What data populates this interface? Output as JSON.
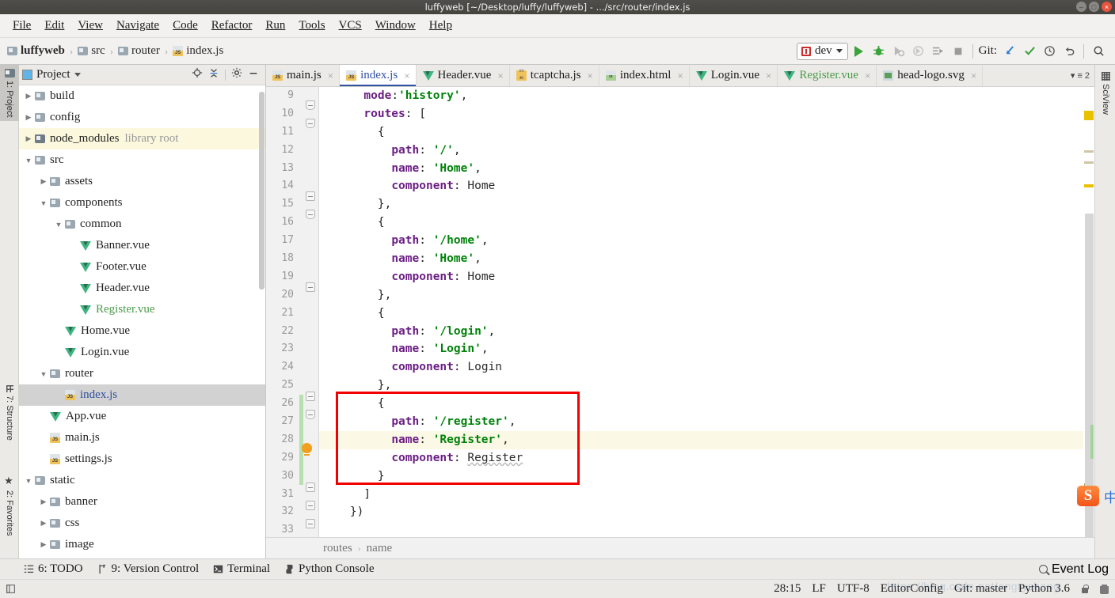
{
  "window": {
    "title": "luffyweb [~/Desktop/luffy/luffyweb] - .../src/router/index.js",
    "minimize_label": "–",
    "maximize_label": "□",
    "close_label": "×"
  },
  "menu": {
    "items": [
      {
        "label": "File"
      },
      {
        "label": "Edit"
      },
      {
        "label": "View"
      },
      {
        "label": "Navigate"
      },
      {
        "label": "Code"
      },
      {
        "label": "Refactor"
      },
      {
        "label": "Run"
      },
      {
        "label": "Tools"
      },
      {
        "label": "VCS"
      },
      {
        "label": "Window"
      },
      {
        "label": "Help"
      }
    ]
  },
  "navbar": {
    "breadcrumbs": [
      {
        "label": "luffyweb",
        "icon": "folder-icon"
      },
      {
        "label": "src",
        "icon": "folder-icon"
      },
      {
        "label": "router",
        "icon": "folder-icon"
      },
      {
        "label": "index.js",
        "icon": "js-file-icon"
      }
    ],
    "separator": "›",
    "run_config": "dev",
    "git_label": "Git:",
    "icons": [
      "run-icon",
      "debug-icon",
      "run-coverage-icon",
      "profile-icon",
      "run-with-dump-icon",
      "stop-icon",
      "update-project-icon",
      "commit-icon",
      "history-icon",
      "rollback-icon",
      "search-everywhere-icon"
    ]
  },
  "left_rail": {
    "items": [
      {
        "label": "1: Project",
        "active": true
      },
      {
        "label": "7: Structure",
        "active": false
      },
      {
        "label": "2: Favorites",
        "active": false
      }
    ]
  },
  "right_rail": {
    "items": [
      {
        "label": "SciView"
      }
    ]
  },
  "project_panel": {
    "title": "Project",
    "tree": [
      {
        "label": "build",
        "indent": 1,
        "arrow": "collapsed",
        "icon": "folder-icon",
        "style": "normal"
      },
      {
        "label": "config",
        "indent": 1,
        "arrow": "collapsed",
        "icon": "folder-icon",
        "style": "normal"
      },
      {
        "label": "node_modules",
        "sub": "library root",
        "indent": 1,
        "arrow": "collapsed",
        "icon": "folder-dark-icon",
        "style": "yellow"
      },
      {
        "label": "src",
        "indent": 1,
        "arrow": "expanded",
        "icon": "folder-icon",
        "style": "normal"
      },
      {
        "label": "assets",
        "indent": 2,
        "arrow": "collapsed",
        "icon": "folder-icon",
        "style": "normal"
      },
      {
        "label": "components",
        "indent": 2,
        "arrow": "expanded",
        "icon": "folder-icon",
        "style": "normal"
      },
      {
        "label": "common",
        "indent": 3,
        "arrow": "expanded",
        "icon": "folder-icon",
        "style": "normal"
      },
      {
        "label": "Banner.vue",
        "indent": 4,
        "arrow": "none",
        "icon": "vue-file-icon",
        "style": "normal"
      },
      {
        "label": "Footer.vue",
        "indent": 4,
        "arrow": "none",
        "icon": "vue-file-icon",
        "style": "normal"
      },
      {
        "label": "Header.vue",
        "indent": 4,
        "arrow": "none",
        "icon": "vue-file-icon",
        "style": "normal"
      },
      {
        "label": "Register.vue",
        "indent": 4,
        "arrow": "none",
        "icon": "vue-file-icon",
        "style": "green"
      },
      {
        "label": "Home.vue",
        "indent": 3,
        "arrow": "none",
        "icon": "vue-file-icon",
        "style": "normal"
      },
      {
        "label": "Login.vue",
        "indent": 3,
        "arrow": "none",
        "icon": "vue-file-icon",
        "style": "normal"
      },
      {
        "label": "router",
        "indent": 2,
        "arrow": "expanded",
        "icon": "folder-icon",
        "style": "normal"
      },
      {
        "label": "index.js",
        "indent": 3,
        "arrow": "none",
        "icon": "js-file-icon",
        "style": "selected"
      },
      {
        "label": "App.vue",
        "indent": 2,
        "arrow": "none",
        "icon": "vue-file-icon",
        "style": "normal"
      },
      {
        "label": "main.js",
        "indent": 2,
        "arrow": "none",
        "icon": "js-file-icon",
        "style": "normal"
      },
      {
        "label": "settings.js",
        "indent": 2,
        "arrow": "none",
        "icon": "js-file-icon",
        "style": "normal"
      },
      {
        "label": "static",
        "indent": 1,
        "arrow": "expanded",
        "icon": "folder-icon",
        "style": "normal"
      },
      {
        "label": "banner",
        "indent": 2,
        "arrow": "collapsed",
        "icon": "folder-icon",
        "style": "normal"
      },
      {
        "label": "css",
        "indent": 2,
        "arrow": "collapsed",
        "icon": "folder-icon",
        "style": "normal"
      },
      {
        "label": "image",
        "indent": 2,
        "arrow": "collapsed",
        "icon": "folder-icon",
        "style": "normal"
      }
    ]
  },
  "editor": {
    "tabs": [
      {
        "label": "main.js",
        "icon": "js-file-icon",
        "active": false,
        "color": "normal"
      },
      {
        "label": "index.js",
        "icon": "js-file-icon",
        "active": true,
        "color": "normal"
      },
      {
        "label": "Header.vue",
        "icon": "vue-file-icon",
        "active": false,
        "color": "normal"
      },
      {
        "label": "tcaptcha.js",
        "icon": "js-min-file-icon",
        "active": false,
        "color": "normal"
      },
      {
        "label": "index.html",
        "icon": "html-file-icon",
        "active": false,
        "color": "normal"
      },
      {
        "label": "Login.vue",
        "icon": "vue-file-icon",
        "active": false,
        "color": "normal"
      },
      {
        "label": "Register.vue",
        "icon": "vue-file-icon",
        "active": false,
        "color": "green"
      },
      {
        "label": "head-logo.svg",
        "icon": "svg-file-icon",
        "active": false,
        "color": "normal"
      }
    ],
    "tab_close_label": "×",
    "tab_overflow_count": "2",
    "first_line_number": 9,
    "lines": [
      {
        "n": 9,
        "tokens": [
          {
            "t": "      ",
            "c": "punc"
          },
          {
            "t": "mode",
            "c": "prop"
          },
          {
            "t": ":",
            "c": "punc"
          },
          {
            "t": "'history'",
            "c": "str"
          },
          {
            "t": ",",
            "c": "punc"
          }
        ]
      },
      {
        "n": 10,
        "tokens": [
          {
            "t": "      ",
            "c": "punc"
          },
          {
            "t": "routes",
            "c": "prop"
          },
          {
            "t": ": [",
            "c": "punc"
          }
        ]
      },
      {
        "n": 11,
        "tokens": [
          {
            "t": "        {",
            "c": "punc"
          }
        ]
      },
      {
        "n": 12,
        "tokens": [
          {
            "t": "          ",
            "c": "punc"
          },
          {
            "t": "path",
            "c": "prop"
          },
          {
            "t": ": ",
            "c": "punc"
          },
          {
            "t": "'/'",
            "c": "str"
          },
          {
            "t": ",",
            "c": "punc"
          }
        ]
      },
      {
        "n": 13,
        "tokens": [
          {
            "t": "          ",
            "c": "punc"
          },
          {
            "t": "name",
            "c": "prop"
          },
          {
            "t": ": ",
            "c": "punc"
          },
          {
            "t": "'Home'",
            "c": "str"
          },
          {
            "t": ",",
            "c": "punc"
          }
        ]
      },
      {
        "n": 14,
        "tokens": [
          {
            "t": "          ",
            "c": "punc"
          },
          {
            "t": "component",
            "c": "prop"
          },
          {
            "t": ": ",
            "c": "punc"
          },
          {
            "t": "Home",
            "c": "id"
          }
        ]
      },
      {
        "n": 15,
        "tokens": [
          {
            "t": "        },",
            "c": "punc"
          }
        ]
      },
      {
        "n": 16,
        "tokens": [
          {
            "t": "        {",
            "c": "punc"
          }
        ]
      },
      {
        "n": 17,
        "tokens": [
          {
            "t": "          ",
            "c": "punc"
          },
          {
            "t": "path",
            "c": "prop"
          },
          {
            "t": ": ",
            "c": "punc"
          },
          {
            "t": "'/home'",
            "c": "str"
          },
          {
            "t": ",",
            "c": "punc"
          }
        ]
      },
      {
        "n": 18,
        "tokens": [
          {
            "t": "          ",
            "c": "punc"
          },
          {
            "t": "name",
            "c": "prop"
          },
          {
            "t": ": ",
            "c": "punc"
          },
          {
            "t": "'Home'",
            "c": "str"
          },
          {
            "t": ",",
            "c": "punc"
          }
        ]
      },
      {
        "n": 19,
        "tokens": [
          {
            "t": "          ",
            "c": "punc"
          },
          {
            "t": "component",
            "c": "prop"
          },
          {
            "t": ": ",
            "c": "punc"
          },
          {
            "t": "Home",
            "c": "id"
          }
        ]
      },
      {
        "n": 20,
        "tokens": [
          {
            "t": "        },",
            "c": "punc"
          }
        ]
      },
      {
        "n": 21,
        "tokens": [
          {
            "t": "        {",
            "c": "punc"
          }
        ]
      },
      {
        "n": 22,
        "tokens": [
          {
            "t": "          ",
            "c": "punc"
          },
          {
            "t": "path",
            "c": "prop"
          },
          {
            "t": ": ",
            "c": "punc"
          },
          {
            "t": "'/login'",
            "c": "str"
          },
          {
            "t": ",",
            "c": "punc"
          }
        ]
      },
      {
        "n": 23,
        "tokens": [
          {
            "t": "          ",
            "c": "punc"
          },
          {
            "t": "name",
            "c": "prop"
          },
          {
            "t": ": ",
            "c": "punc"
          },
          {
            "t": "'Login'",
            "c": "str"
          },
          {
            "t": ",",
            "c": "punc"
          }
        ]
      },
      {
        "n": 24,
        "tokens": [
          {
            "t": "          ",
            "c": "punc"
          },
          {
            "t": "component",
            "c": "prop"
          },
          {
            "t": ": ",
            "c": "punc"
          },
          {
            "t": "Login",
            "c": "id"
          }
        ]
      },
      {
        "n": 25,
        "tokens": [
          {
            "t": "        },",
            "c": "punc"
          }
        ]
      },
      {
        "n": 26,
        "tokens": [
          {
            "t": "        {",
            "c": "punc"
          }
        ]
      },
      {
        "n": 27,
        "tokens": [
          {
            "t": "          ",
            "c": "punc"
          },
          {
            "t": "path",
            "c": "prop"
          },
          {
            "t": ": ",
            "c": "punc"
          },
          {
            "t": "'/register'",
            "c": "str"
          },
          {
            "t": ",",
            "c": "punc"
          }
        ]
      },
      {
        "n": 28,
        "tokens": [
          {
            "t": "          ",
            "c": "punc"
          },
          {
            "t": "name",
            "c": "prop"
          },
          {
            "t": ": ",
            "c": "punc"
          },
          {
            "t": "'Register'",
            "c": "str"
          },
          {
            "t": ",",
            "c": "punc"
          }
        ],
        "current": true
      },
      {
        "n": 29,
        "tokens": [
          {
            "t": "          ",
            "c": "punc"
          },
          {
            "t": "component",
            "c": "prop"
          },
          {
            "t": ": ",
            "c": "punc"
          },
          {
            "t": "Register",
            "c": "id-wavy"
          }
        ]
      },
      {
        "n": 30,
        "tokens": [
          {
            "t": "        }",
            "c": "punc"
          }
        ]
      },
      {
        "n": 31,
        "tokens": [
          {
            "t": "      ]",
            "c": "punc"
          }
        ]
      },
      {
        "n": 32,
        "tokens": [
          {
            "t": "    })",
            "c": "punc"
          }
        ]
      },
      {
        "n": 33,
        "tokens": [
          {
            "t": "",
            "c": "punc"
          }
        ]
      }
    ],
    "bottom_breadcrumb": [
      "routes",
      "name"
    ],
    "bottom_breadcrumb_sep": "›"
  },
  "bottom_bar": {
    "items": [
      {
        "label": "6: TODO",
        "icon": "todo-icon"
      },
      {
        "label": "9: Version Control",
        "icon": "branch-icon"
      },
      {
        "label": "Terminal",
        "icon": "terminal-icon"
      },
      {
        "label": "Python Console",
        "icon": "python-icon"
      }
    ],
    "event_log": "Event Log"
  },
  "status_bar": {
    "caret_position": "28:15",
    "line_separator": "LF",
    "encoding": "UTF-8",
    "editor_config": "EditorConfig",
    "git_branch": "Git: master",
    "interpreter": "Python 3.6",
    "icons": [
      "lock-icon",
      "trash-icon"
    ]
  },
  "ime": {
    "logo_label": "S",
    "mode_label": "中"
  },
  "watermark": {
    "text": "https://blog.csdn.net/angrysheng"
  },
  "colors": {
    "accent_blue": "#3151a3",
    "string_green": "#00820a",
    "property_purple": "#6b1f84",
    "annotation_red": "#f20000",
    "current_line": "#fcf8e6",
    "vcs_green": "#b7dfb0"
  }
}
